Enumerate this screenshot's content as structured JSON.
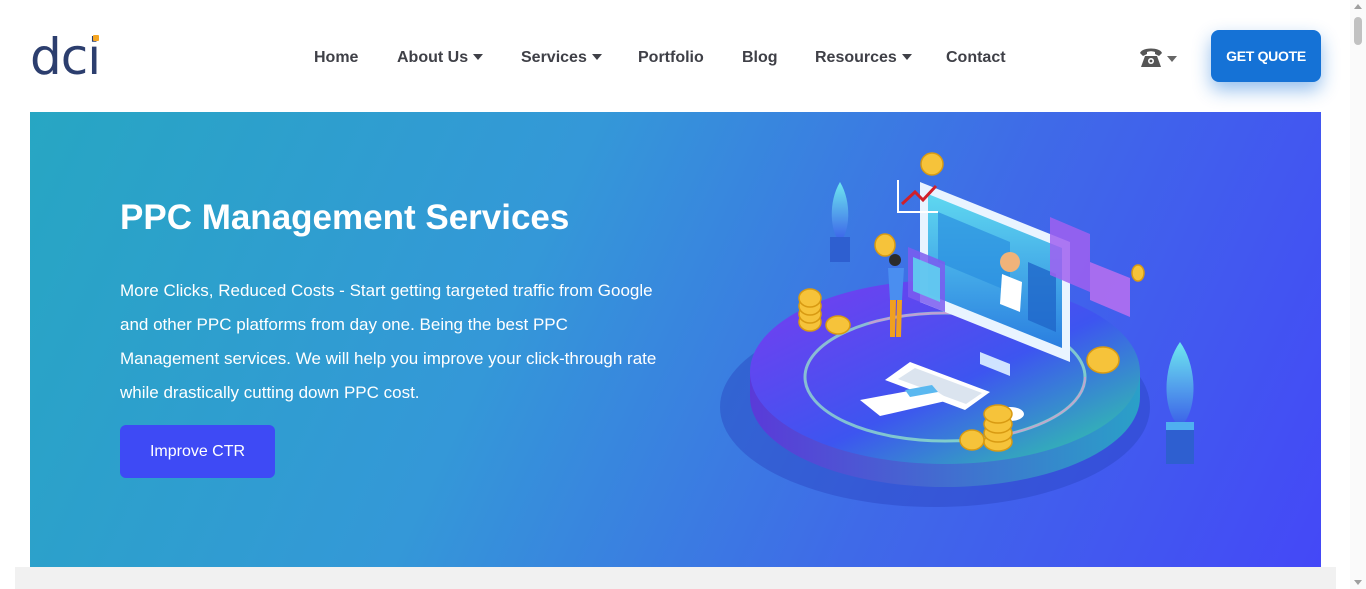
{
  "header": {
    "logo_text": "dci",
    "nav": [
      {
        "label": "Home",
        "has_dropdown": false
      },
      {
        "label": "About Us",
        "has_dropdown": true
      },
      {
        "label": "Services",
        "has_dropdown": true
      },
      {
        "label": "Portfolio",
        "has_dropdown": false
      },
      {
        "label": "Blog",
        "has_dropdown": false
      },
      {
        "label": "Resources",
        "has_dropdown": true
      },
      {
        "label": "Contact",
        "has_dropdown": false
      }
    ],
    "phone_icon": "phone-icon",
    "cta_label": "GET QUOTE"
  },
  "hero": {
    "title": "PPC Management Services",
    "description": "More Clicks, Reduced Costs - Start getting targeted traffic from Google and other PPC platforms from day one. Being the best PPC Management services. We will help you improve your click-through rate while drastically cutting down PPC cost.",
    "button_label": "Improve CTR",
    "illustration": "ppc-isometric-illustration"
  },
  "colors": {
    "brand_blue": "#1572d6",
    "hero_gradient_start": "#27a6c3",
    "hero_gradient_end": "#4448f7",
    "button_purple": "#3e4af5",
    "logo_navy": "#2c3e6e",
    "logo_accent": "#f5a623"
  }
}
